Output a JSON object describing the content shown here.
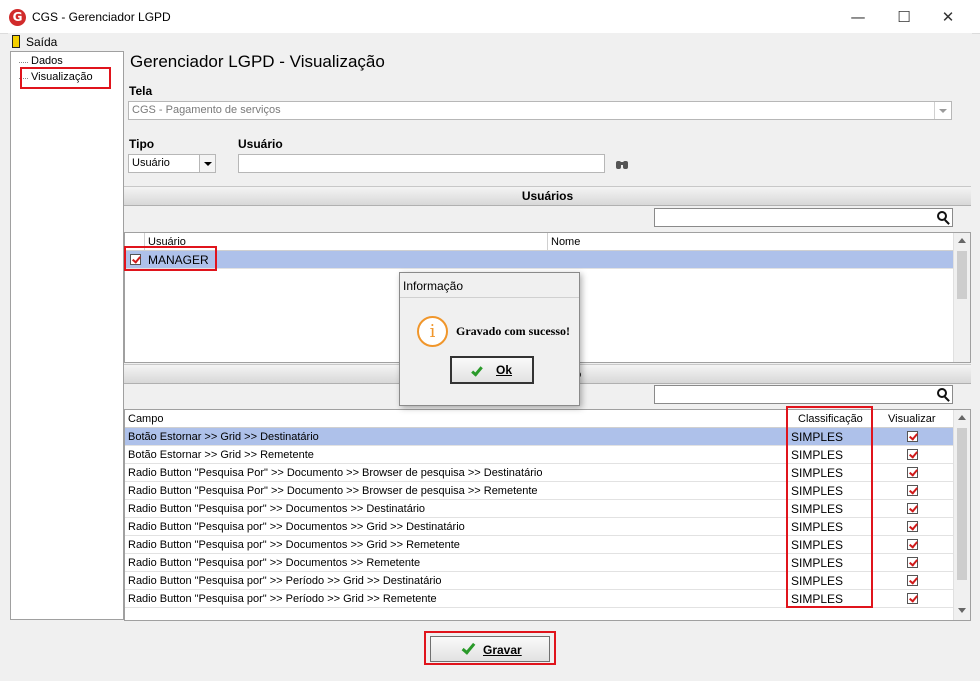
{
  "window": {
    "title": "CGS - Gerenciador LGPD",
    "logo_letter": "G",
    "minimize": "—",
    "maximize": "☐",
    "close": "✕"
  },
  "menu": {
    "exit_label": "Saída"
  },
  "tree": {
    "items": [
      {
        "label": "Dados"
      },
      {
        "label": "Visualização"
      }
    ]
  },
  "page": {
    "title": "Gerenciador LGPD - Visualização"
  },
  "tela": {
    "label": "Tela",
    "value": "CGS - Pagamento de serviços"
  },
  "tipo": {
    "label": "Tipo",
    "value": "Usuário"
  },
  "usuario": {
    "label": "Usuário",
    "value": ""
  },
  "users_section": {
    "header": "Usuários",
    "columns": [
      "Usuário",
      "Nome"
    ],
    "rows": [
      {
        "usuario": "MANAGER",
        "nome": "",
        "checked": true
      }
    ]
  },
  "fields_section": {
    "header_suffix": "o",
    "columns": [
      "Campo",
      "Classificação",
      "Visualizar"
    ],
    "rows": [
      {
        "campo": "Botão Estornar >> Grid >> Destinatário",
        "classificacao": "SIMPLES",
        "visualizar": true
      },
      {
        "campo": "Botão Estornar >> Grid >> Remetente",
        "classificacao": "SIMPLES",
        "visualizar": true
      },
      {
        "campo": "Radio Button \"Pesquisa Por\" >> Documento >> Browser de pesquisa >> Destinatário",
        "classificacao": "SIMPLES",
        "visualizar": true
      },
      {
        "campo": "Radio Button \"Pesquisa Por\" >> Documento >> Browser de pesquisa >> Remetente",
        "classificacao": "SIMPLES",
        "visualizar": true
      },
      {
        "campo": "Radio Button \"Pesquisa por\" >> Documentos >> Destinatário",
        "classificacao": "SIMPLES",
        "visualizar": true
      },
      {
        "campo": "Radio Button \"Pesquisa por\" >> Documentos >> Grid >> Destinatário",
        "classificacao": "SIMPLES",
        "visualizar": true
      },
      {
        "campo": "Radio Button \"Pesquisa por\" >> Documentos >> Grid >> Remetente",
        "classificacao": "SIMPLES",
        "visualizar": true
      },
      {
        "campo": "Radio Button \"Pesquisa por\" >> Documentos >> Remetente",
        "classificacao": "SIMPLES",
        "visualizar": true
      },
      {
        "campo": "Radio Button \"Pesquisa por\" >> Período >> Grid >> Destinatário",
        "classificacao": "SIMPLES",
        "visualizar": true
      },
      {
        "campo": "Radio Button \"Pesquisa por\" >> Período >> Grid >> Remetente",
        "classificacao": "SIMPLES",
        "visualizar": true
      }
    ]
  },
  "dialog": {
    "title": "Informação",
    "message": "Gravado com sucesso!",
    "ok_label": "Ok"
  },
  "footer": {
    "save_label": "Gravar"
  },
  "colors": {
    "highlight": "#e0141c",
    "selection": "#aec1ea",
    "check": "#d01a1a",
    "accept": "#2a9a2a"
  }
}
